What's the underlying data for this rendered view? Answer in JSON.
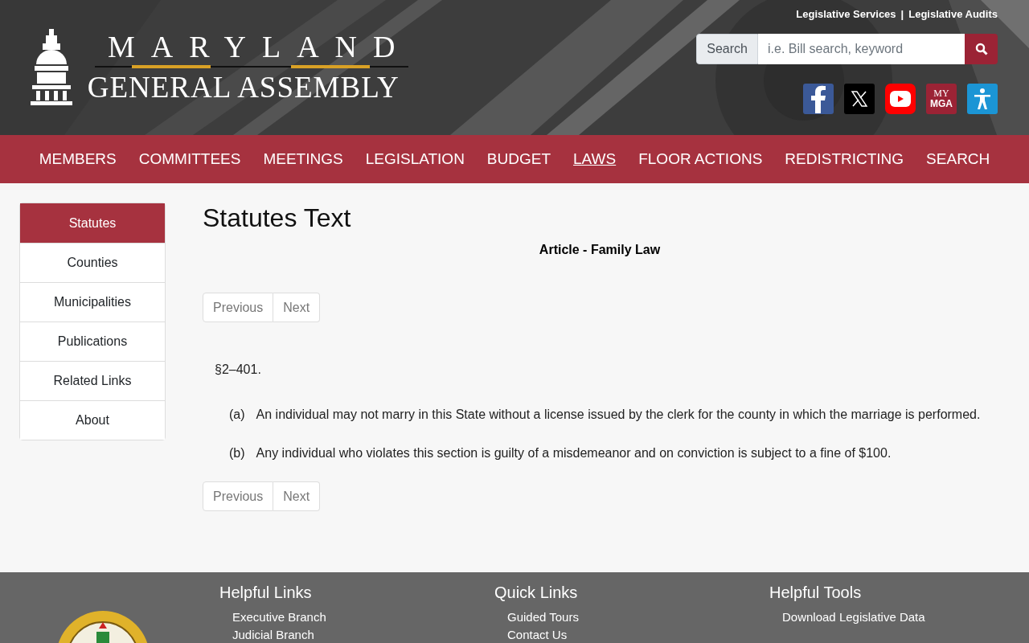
{
  "header": {
    "top_links": [
      "Legislative Services",
      "|",
      "Legislative Audits"
    ],
    "logo": {
      "line1": "MARYLAND",
      "line2": "GENERAL ASSEMBLY"
    },
    "search": {
      "label": "Search",
      "placeholder": "i.e. Bill search, keyword"
    },
    "social": [
      {
        "kind": "facebook"
      },
      {
        "kind": "x"
      },
      {
        "kind": "youtube"
      },
      {
        "kind": "mymga",
        "line1": "MY",
        "line2": "MGA"
      },
      {
        "kind": "accessibility"
      }
    ]
  },
  "nav": [
    {
      "label": "MEMBERS",
      "selected": false
    },
    {
      "label": "COMMITTEES",
      "selected": false
    },
    {
      "label": "MEETINGS",
      "selected": false
    },
    {
      "label": "LEGISLATION",
      "selected": false
    },
    {
      "label": "BUDGET",
      "selected": false
    },
    {
      "label": "LAWS",
      "selected": true
    },
    {
      "label": "FLOOR ACTIONS",
      "selected": false
    },
    {
      "label": "REDISTRICTING",
      "selected": false
    },
    {
      "label": "SEARCH",
      "selected": false
    }
  ],
  "sidebar": [
    {
      "label": "Statutes",
      "selected": true
    },
    {
      "label": "Counties",
      "selected": false
    },
    {
      "label": "Municipalities",
      "selected": false
    },
    {
      "label": "Publications",
      "selected": false
    },
    {
      "label": "Related Links",
      "selected": false
    },
    {
      "label": "About",
      "selected": false
    }
  ],
  "content": {
    "title": "Statutes Text",
    "article": "Article - Family Law",
    "pager": [
      "Previous",
      "Next"
    ],
    "section": "§2–401.",
    "paragraphs": [
      {
        "mark": "(a)",
        "text": "An individual may not marry in this State without a license issued by the clerk for the county in which the marriage is performed."
      },
      {
        "mark": "(b)",
        "text": "Any individual who violates this section is guilty of a misdemeanor and on conviction is subject to a fine of $100."
      }
    ],
    "pager_bottom": [
      "Previous",
      "Next"
    ]
  },
  "footer": {
    "columns": [
      {
        "title": "Helpful Links",
        "links": [
          "Executive Branch",
          "Judicial Branch"
        ]
      },
      {
        "title": "Quick Links",
        "links": [
          "Guided Tours",
          "Contact Us"
        ]
      },
      {
        "title": "Helpful Tools",
        "links": [
          "Download Legislative Data"
        ]
      }
    ]
  }
}
